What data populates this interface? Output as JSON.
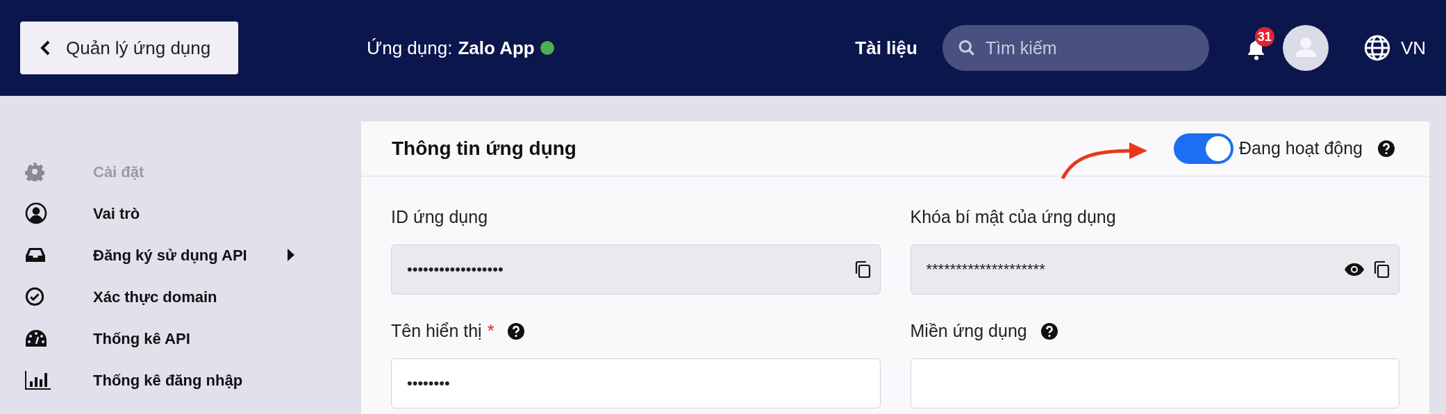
{
  "header": {
    "back_button": "Quản lý ứng dụng",
    "app_label": "Ứng dụng:",
    "app_name": "Zalo App",
    "app_online": true,
    "docs_link": "Tài liệu",
    "search": {
      "placeholder": "Tìm kiếm"
    },
    "notification_count": "31",
    "language": "VN"
  },
  "sidebar": {
    "items": [
      {
        "label": "Cài đặt",
        "kind": "heading",
        "has_submenu": false
      },
      {
        "label": "Vai trò",
        "kind": "link",
        "has_submenu": false
      },
      {
        "label": "Đăng ký sử dụng API",
        "kind": "link",
        "has_submenu": true
      },
      {
        "label": "Xác thực domain",
        "kind": "link",
        "has_submenu": false
      },
      {
        "label": "Thống kê API",
        "kind": "link",
        "has_submenu": false
      },
      {
        "label": "Thống kê đăng nhập",
        "kind": "link",
        "has_submenu": false
      }
    ]
  },
  "card": {
    "title": "Thông tin ứng dụng",
    "status_toggle": {
      "on": true,
      "label": "Đang hoạt động"
    },
    "fields": [
      {
        "label": "ID ứng dụng",
        "value": "••••••••••••••••••",
        "readonly": true,
        "help": false,
        "revealable": false,
        "copyable": true
      },
      {
        "label": "Khóa bí mật của ứng dụng",
        "value": "********************",
        "readonly": true,
        "help": false,
        "revealable": true,
        "copyable": true
      },
      {
        "label": "Tên hiển thị",
        "required_mark": "*",
        "value": "••••••••",
        "readonly": false,
        "help": true,
        "revealable": false,
        "copyable": false
      },
      {
        "label": "Miền ứng dụng",
        "readonly": false,
        "help": true,
        "revealable": false,
        "copyable": false
      }
    ]
  }
}
